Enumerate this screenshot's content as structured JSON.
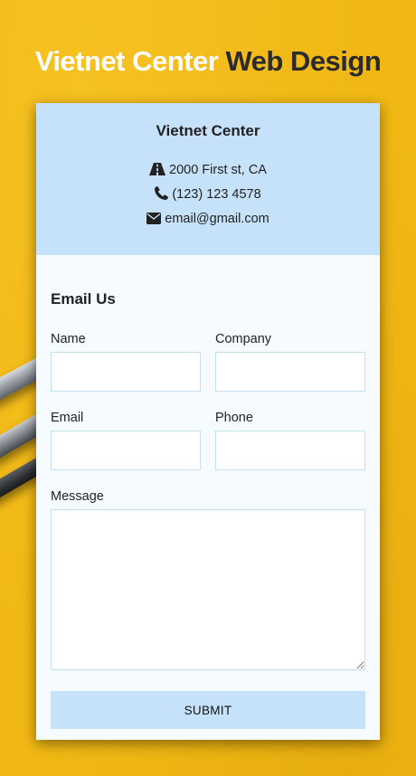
{
  "header": {
    "title_part1": "Vietnet Center",
    "title_part2": "Web Design"
  },
  "contact": {
    "company": "Vietnet Center",
    "address": "2000 First st, CA",
    "phone": "(123) 123 4578",
    "email": "email@gmail.com",
    "icons": {
      "address": "road-icon",
      "phone": "phone-icon",
      "email": "envelope-icon"
    }
  },
  "form": {
    "title": "Email Us",
    "name_label": "Name",
    "company_label": "Company",
    "email_label": "Email",
    "phone_label": "Phone",
    "message_label": "Message",
    "submit_label": "SUBMIT"
  },
  "colors": {
    "background": "#f1b814",
    "panel": "#c6e2fa",
    "card": "#f5fbff",
    "input_border": "#c3e1ef",
    "text": "#222222"
  }
}
